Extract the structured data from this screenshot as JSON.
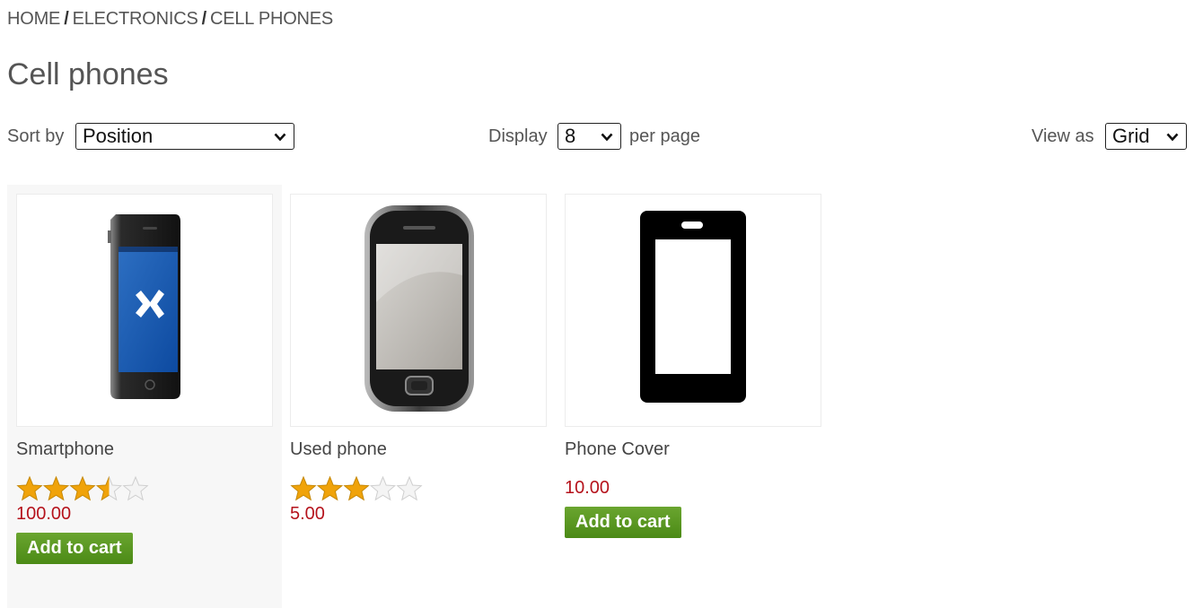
{
  "breadcrumb": [
    "HOME",
    "ELECTRONICS",
    "CELL PHONES"
  ],
  "breadcrumb_separator": "/",
  "page_title": "Cell phones",
  "toolbar": {
    "sort_label": "Sort by",
    "sort_value": "Position",
    "display_label": "Display",
    "display_value": "8",
    "per_page_label": "per page",
    "view_label": "View as",
    "view_value": "Grid"
  },
  "products": [
    {
      "name": "Smartphone",
      "rating": 3.5,
      "price": "100.00",
      "button": "Add to cart",
      "image": "smartphone-image"
    },
    {
      "name": "Used phone",
      "rating": 3,
      "price": "5.00",
      "button": "Add to cart",
      "image": "used-phone-image"
    },
    {
      "name": "Phone Cover",
      "price": "10.00",
      "button": "Add to cart",
      "image": "phone-cover-image"
    }
  ],
  "colors": {
    "price": "#b5121b",
    "button": "#5a9a22",
    "star": "#f0a30a"
  }
}
